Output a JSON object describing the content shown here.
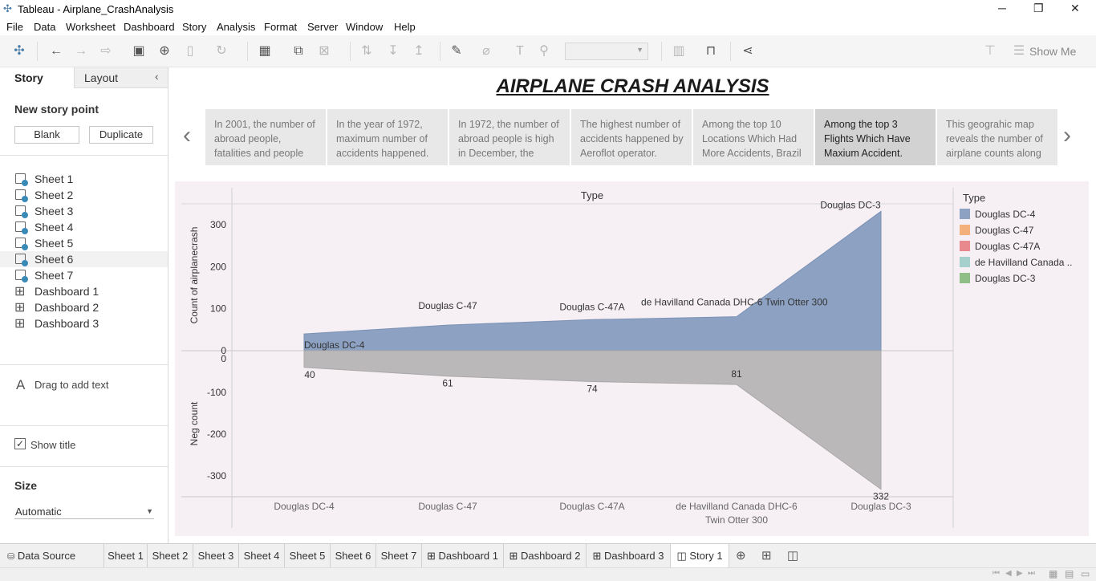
{
  "window": {
    "title": "Tableau - Airplane_CrashAnalysis"
  },
  "menu": [
    "File",
    "Data",
    "Worksheet",
    "Dashboard",
    "Story",
    "Analysis",
    "Format",
    "Server",
    "Window",
    "Help"
  ],
  "toolbar": {
    "show_me": "Show Me"
  },
  "left_panel": {
    "tab_story": "Story",
    "tab_layout": "Layout",
    "new_story_point": "New story point",
    "blank_button": "Blank",
    "duplicate_button": "Duplicate",
    "sheets": [
      "Sheet 1",
      "Sheet 2",
      "Sheet 3",
      "Sheet 4",
      "Sheet 5",
      "Sheet 6",
      "Sheet 7"
    ],
    "dashboards": [
      "Dashboard 1",
      "Dashboard 2",
      "Dashboard 3"
    ],
    "drag_text": "Drag to add text",
    "show_title": "Show title",
    "size_label": "Size",
    "size_value": "Automatic"
  },
  "story": {
    "title": "AIRPLANE CRASH ANALYSIS",
    "points": [
      "In 2001, the number of abroad people, fatalities and people",
      "In the year of 1972, maximum number of accidents happened.",
      "In 1972, the number of abroad people is high in  December, the",
      "The highest number of accidents happened by Aeroflot operator.",
      "Among the top 10 Locations Which Had More Accidents, Brazil",
      "Among the top 3 Flights Which Have Maxium Accident.",
      "This geograhic map reveals the number of airplane counts along"
    ],
    "active_point": 5
  },
  "chart_data": {
    "type": "area",
    "header": "Type",
    "categories": [
      "Douglas DC-4",
      "Douglas C-47",
      "Douglas C-47A",
      "de Havilland Canada DHC-6 Twin Otter 300",
      "Douglas DC-3"
    ],
    "x_tick_labels": [
      "Douglas DC-4",
      "Douglas C-47",
      "Douglas C-47A",
      "de Havilland Canada DHC-6",
      "Douglas DC-3"
    ],
    "x_tick_labels_line2": [
      "",
      "",
      "",
      "Twin Otter 300",
      ""
    ],
    "top": {
      "ylabel": "Count of airplanecrash",
      "ylim": [
        0,
        350
      ],
      "yticks": [
        0,
        100,
        200,
        300
      ],
      "values": [
        40,
        61,
        74,
        81,
        332
      ],
      "color": "#8da2c3",
      "labels": [
        "Douglas DC-4",
        "Douglas C-47",
        "Douglas C-47A",
        "de Havilland Canada DHC-6 Twin Otter 300",
        "Douglas DC-3"
      ]
    },
    "bottom": {
      "ylabel": "Neg count",
      "ylim": [
        -350,
        0
      ],
      "yticks": [
        0,
        -100,
        -200,
        -300
      ],
      "values": [
        -40,
        -61,
        -74,
        -81,
        -332
      ],
      "color": "#bab8b9",
      "labels": [
        "40",
        "61",
        "74",
        "81",
        "332"
      ]
    },
    "legend": {
      "title": "Type",
      "placement": "right",
      "items": [
        {
          "name": "Douglas DC-4",
          "color": "#8da2c3"
        },
        {
          "name": "Douglas C-47",
          "color": "#f4b07a"
        },
        {
          "name": "Douglas C-47A",
          "color": "#e8898d"
        },
        {
          "name": "de Havilland Canada ..",
          "color": "#a6d0cb"
        },
        {
          "name": "Douglas DC-3",
          "color": "#8fbe87"
        }
      ]
    }
  },
  "bottom_tabs": [
    "Data Source",
    "Sheet 1",
    "Sheet 2",
    "Sheet 3",
    "Sheet 4",
    "Sheet 5",
    "Sheet 6",
    "Sheet 7",
    "Dashboard 1",
    "Dashboard 2",
    "Dashboard 3",
    "Story 1"
  ]
}
